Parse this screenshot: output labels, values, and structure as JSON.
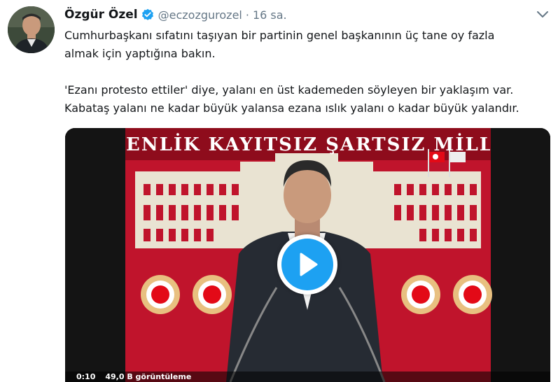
{
  "tweet": {
    "display_name": "Özgür Özel",
    "handle": "@eczozgurozel",
    "separator": "·",
    "timestamp": "16 sa.",
    "text_lines": [
      "Cumhurbaşkanı sıfatını taşıyan bir partinin genel başkanının üç tane oy fazla",
      "almak için yaptığına bakın.",
      "'Ezanı protesto ettiler' diye, yalanı en üst kademeden söyleyen bir yaklaşım var.",
      "Kabataş yalanı ne kadar büyük yalansa ezana ıslık yalanı o kadar büyük yalandır."
    ]
  },
  "media": {
    "banner_text": "ENLİK KAYITSIZ ŞARTSIZ MİLLETİNDİ",
    "video_time": "0:10",
    "video_views": "49,0 B görüntüleme"
  },
  "colors": {
    "accent": "#1da1f2",
    "verified": "#1da1f2",
    "banner_red": "#c8102e",
    "muted_text": "#657786"
  },
  "icons": {
    "verified": "verified-badge-icon",
    "caret": "chevron-down-icon",
    "play": "play-icon"
  }
}
